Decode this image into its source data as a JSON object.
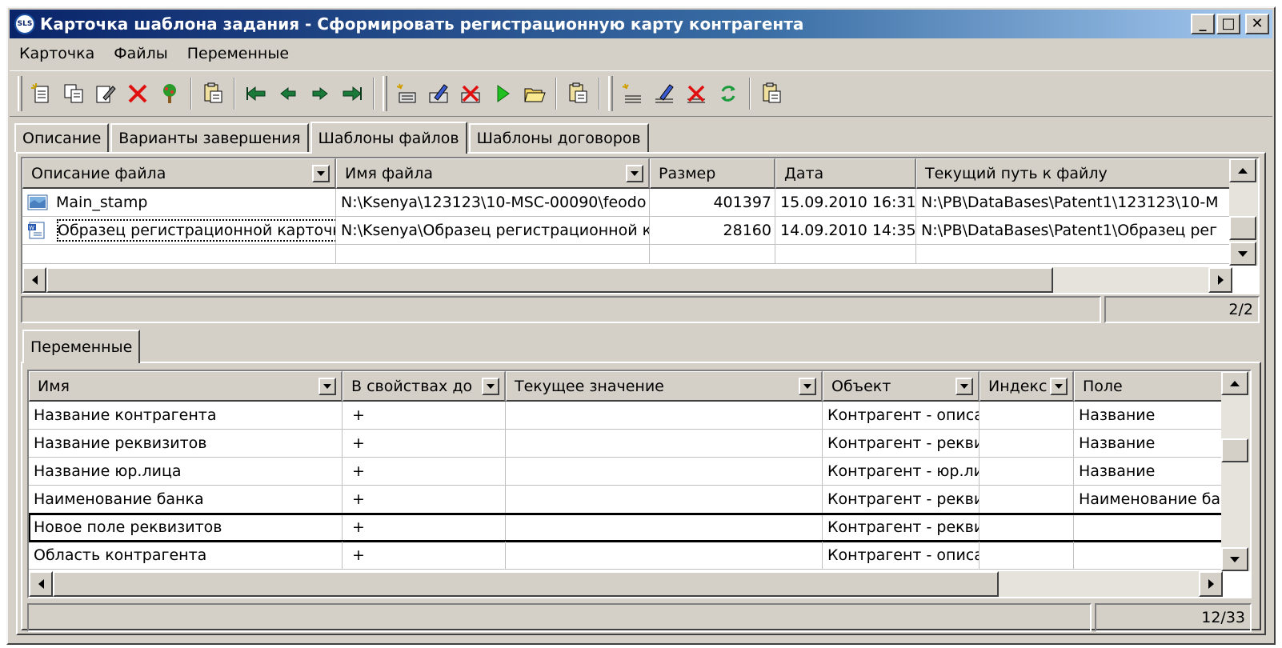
{
  "window": {
    "title": "Карточка шаблона задания - Сформировать регистрационную карту контрагента",
    "app_icon_text": "SLS",
    "minimize": "_",
    "maximize": "□",
    "close": "✕"
  },
  "menu": [
    "Карточка",
    "Файлы",
    "Переменные"
  ],
  "toolbar_icons": [
    "new-doc-icon",
    "copy-icon",
    "edit-icon",
    "delete-icon",
    "tree-icon",
    "clipboard-icon",
    "first-icon",
    "prev-icon",
    "next-icon",
    "last-icon",
    "add-file-icon",
    "edit-file-icon",
    "delete-file-icon",
    "run-icon",
    "open-folder-icon",
    "clipboard-icon",
    "add-var-icon",
    "edit-var-icon",
    "delete-var-icon",
    "refresh-icon",
    "clipboard-icon"
  ],
  "tabs": [
    "Описание",
    "Варианты завершения",
    "Шаблоны файлов",
    "Шаблоны договоров"
  ],
  "active_tab": 2,
  "files_grid": {
    "columns": [
      "Описание файла",
      "Имя файла",
      "Размер",
      "Дата",
      "Текущий путь к файлу"
    ],
    "rows": [
      [
        "Main_stamp",
        "N:\\Ksenya\\123123\\10-MSC-00090\\feodo",
        "401397",
        "15.09.2010 16:31",
        "N:\\PB\\DataBases\\Patent1\\123123\\10-M"
      ],
      [
        "Образец регистрационной карточки",
        "N:\\Ksenya\\Образец регистрационной к",
        "28160",
        "14.09.2010 14:35",
        "N:\\PB\\DataBases\\Patent1\\Образец рег"
      ]
    ],
    "status_count": "2/2"
  },
  "vars_tab": "Переменные",
  "vars_grid": {
    "columns": [
      "Имя",
      "В свойствах до",
      "Текущее значение",
      "Объект",
      "Индекс",
      "Поле"
    ],
    "rows": [
      [
        "Название контрагента",
        "+",
        "",
        "Контрагент - описа",
        "",
        "Название"
      ],
      [
        "Название реквизитов",
        "+",
        "",
        "Контрагент - рекви",
        "",
        "Название"
      ],
      [
        "Название юр.лица",
        "+",
        "",
        "Контрагент - юр.ли",
        "",
        "Название"
      ],
      [
        "Наименование банка",
        "+",
        "",
        "Контрагент - рекви",
        "",
        "Наименование ба"
      ],
      [
        "Новое поле реквизитов",
        "+",
        "",
        "Контрагент - рекви",
        "",
        ""
      ],
      [
        "Область контрагента",
        "+",
        "",
        "Контрагент - описа",
        "",
        ""
      ]
    ],
    "selected_row": 4,
    "status_count": "12/33"
  }
}
